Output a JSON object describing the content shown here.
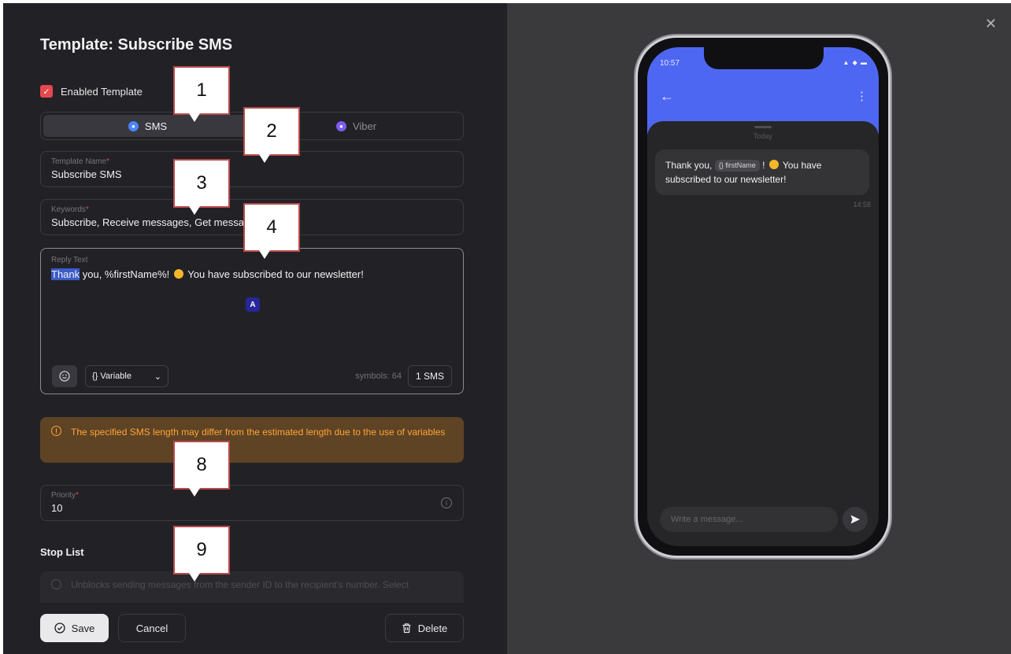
{
  "editor": {
    "title": "Template: Subscribe SMS",
    "enabled_label": "Enabled Template",
    "channel_tabs": [
      {
        "label": "SMS",
        "icon": "sms-icon",
        "active": true
      },
      {
        "label": "Viber",
        "icon": "viber-icon",
        "active": false
      }
    ],
    "template_name": {
      "label": "Template Name",
      "value": "Subscribe SMS"
    },
    "keywords": {
      "label": "Keywords",
      "value": "Subscribe, Receive messages, Get messa"
    },
    "reply": {
      "label": "Reply Text",
      "selected_word": "Thank",
      "text_rest": " you, %firstName%! ",
      "text_after_emoji": " You have subscribed to our newsletter!",
      "variable_select": "Variable",
      "symbols": "symbols: 64",
      "sms_count": "1 SMS"
    },
    "warning": "The specified SMS length may differ from the estimated length due to the use of variables",
    "priority": {
      "label": "Priority",
      "value": "10"
    },
    "stop_list": {
      "title": "Stop List",
      "info": "Unblocks sending messages from the sender ID to the recipient's number. Select"
    },
    "buttons": {
      "save": "Save",
      "cancel": "Cancel",
      "delete": "Delete"
    }
  },
  "callouts": [
    "1",
    "2",
    "3",
    "4",
    "8",
    "9"
  ],
  "preview": {
    "time": "10:57",
    "date_label": "Today",
    "message_before": "Thank you, ",
    "variable_chip": "{} firstName",
    "message_after_chip": " ! ",
    "message_end": " You have subscribed to our newsletter!",
    "message_time": "14:58",
    "composer_placeholder": "Write a message..."
  },
  "colors": {
    "panel_bg": "#222226",
    "preview_bg": "#3a3a3d",
    "accent_red": "#e5484d",
    "phone_header": "#4e67f3",
    "warning_bg": "#5e4325",
    "warning_text": "#ffa534"
  }
}
